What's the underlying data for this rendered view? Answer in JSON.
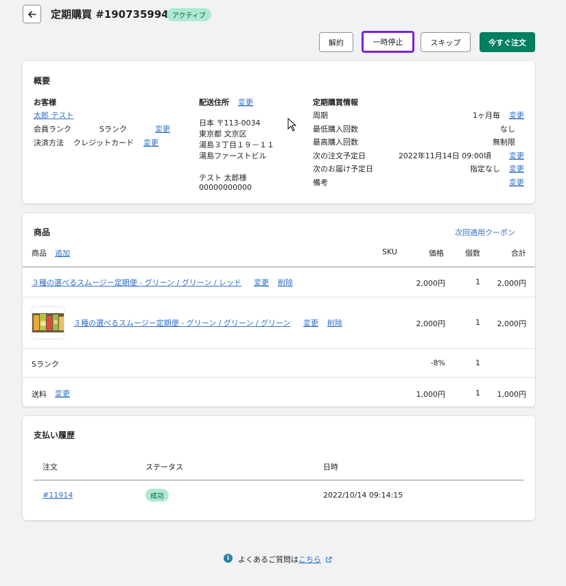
{
  "header": {
    "title": "定期購買 #1907359949",
    "status": "アクティブ"
  },
  "actions": {
    "cancel": "解約",
    "pause": "一時停止",
    "skip": "スキップ",
    "order_now": "今すぐ注文"
  },
  "overview": {
    "title": "概要",
    "customer": {
      "heading": "お客様",
      "name": "太郎 テスト",
      "rank_label": "会員ランク",
      "rank_value": "Sランク",
      "rank_change": "変更",
      "payment_label": "決済方法",
      "payment_value": "クレジットカード",
      "payment_change": "変更"
    },
    "shipping": {
      "heading": "配送住所",
      "change": "変更",
      "line1": "日本 〒113-0034",
      "line2": "東京都 文京区",
      "line3": "湯島３丁目１９－１１",
      "line4": "湯島ファーストビル",
      "recipient": "テスト 太郎様",
      "phone": "00000000000"
    },
    "subscription": {
      "heading": "定期購買情報",
      "rows": [
        {
          "label": "周期",
          "value": "1ヶ月毎",
          "action": "変更"
        },
        {
          "label": "最低購入回数",
          "value": "なし",
          "action": ""
        },
        {
          "label": "最高購入回数",
          "value": "無制限",
          "action": ""
        },
        {
          "label": "次の注文予定日",
          "value": "2022年11月14日 09:00頃",
          "action": "変更"
        },
        {
          "label": "次のお届け予定日",
          "value": "指定なし",
          "action": "変更"
        },
        {
          "label": "備考",
          "value": "",
          "action": "変更"
        }
      ]
    }
  },
  "products": {
    "title": "商品",
    "coupon_link": "次回適用クーポン",
    "columns": {
      "product": "商品",
      "add": "追加",
      "sku": "SKU",
      "price": "価格",
      "qty": "個数",
      "total": "合計"
    },
    "rows": [
      {
        "name": "３種の選べるスムージー定期便 - グリーン / グリーン / レッド",
        "change": "変更",
        "delete": "削除",
        "price": "2,000円",
        "qty": "1",
        "total": "2,000円"
      },
      {
        "name": "３種の選べるスムージー定期便 - グリーン / グリーン / グリーン",
        "change": "変更",
        "delete": "削除",
        "price": "2,000円",
        "qty": "1",
        "total": "2,000円"
      }
    ],
    "discount": {
      "label": "Sランク",
      "price": "-8%",
      "qty": "1"
    },
    "shipping_fee": {
      "label": "送料",
      "change": "変更",
      "price": "1,000円",
      "qty": "1",
      "total": "1,000円"
    }
  },
  "payments": {
    "title": "支払い履歴",
    "columns": {
      "order": "注文",
      "status": "ステータス",
      "date": "日時"
    },
    "rows": [
      {
        "order": "#11914",
        "status": "成功",
        "date": "2022/10/14 09:14:15"
      }
    ]
  },
  "footer": {
    "text": "よくあるご質問は",
    "link": "こちら"
  },
  "colors": {
    "primary": "#008060",
    "link": "#2c6ecb",
    "highlight": "#7a1fe0",
    "success_badge": "#aee9d1"
  }
}
